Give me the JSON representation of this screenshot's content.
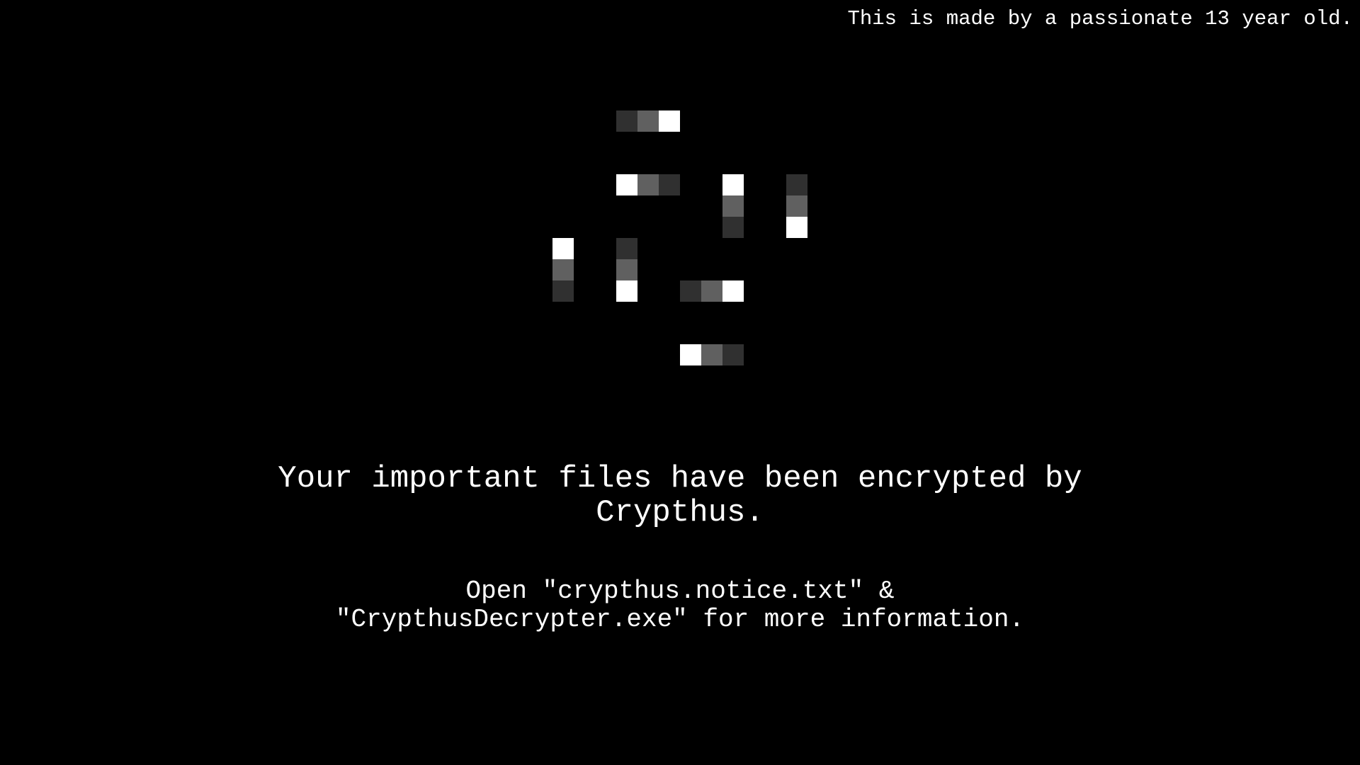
{
  "credit_text": "This is made by a passionate 13 year old.",
  "headline": {
    "line1": "Your important files have been encrypted by",
    "line2": "Crypthus."
  },
  "notice": {
    "line1": "Open \"crypthus.notice.txt\" &",
    "line2": "\"CrypthusDecrypter.exe\" for more information."
  },
  "logo_icon": "spinning-pixel-loader-icon",
  "colors": {
    "background": "#000000",
    "text": "#ffffff",
    "pixel_bright": "#ffffff",
    "pixel_mid": "#606060",
    "pixel_dark": "#303030"
  }
}
